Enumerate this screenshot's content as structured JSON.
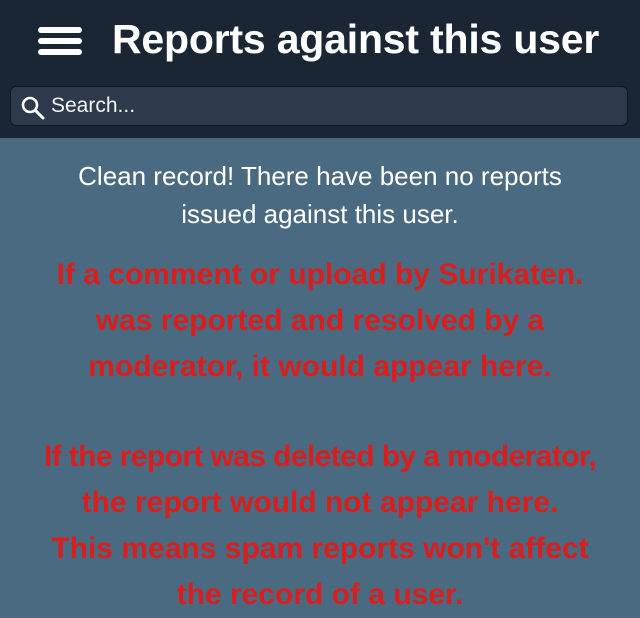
{
  "header": {
    "title": "Reports against this user",
    "menu_icon": "hamburger-menu-icon"
  },
  "search": {
    "placeholder": "Search...",
    "icon": "search-icon"
  },
  "main": {
    "clean_record_line1": "Clean record! There have been no reports",
    "clean_record_line2": "issued against this user.",
    "note1_lines": [
      "If a comment or upload by Surikaten.",
      "was reported and resolved by a",
      "moderator, it would appear here."
    ],
    "note2_lines": [
      "If the report was deleted by a moderator,",
      "the report would not appear here.",
      "This means spam reports won't affect",
      "the record of a user."
    ]
  },
  "colors": {
    "header_bg": "#1b2634",
    "page_bg": "#4a6a82",
    "search_bg": "#2c3a4c",
    "notice_text": "#d91e1e",
    "primary_text": "#ffffff"
  }
}
